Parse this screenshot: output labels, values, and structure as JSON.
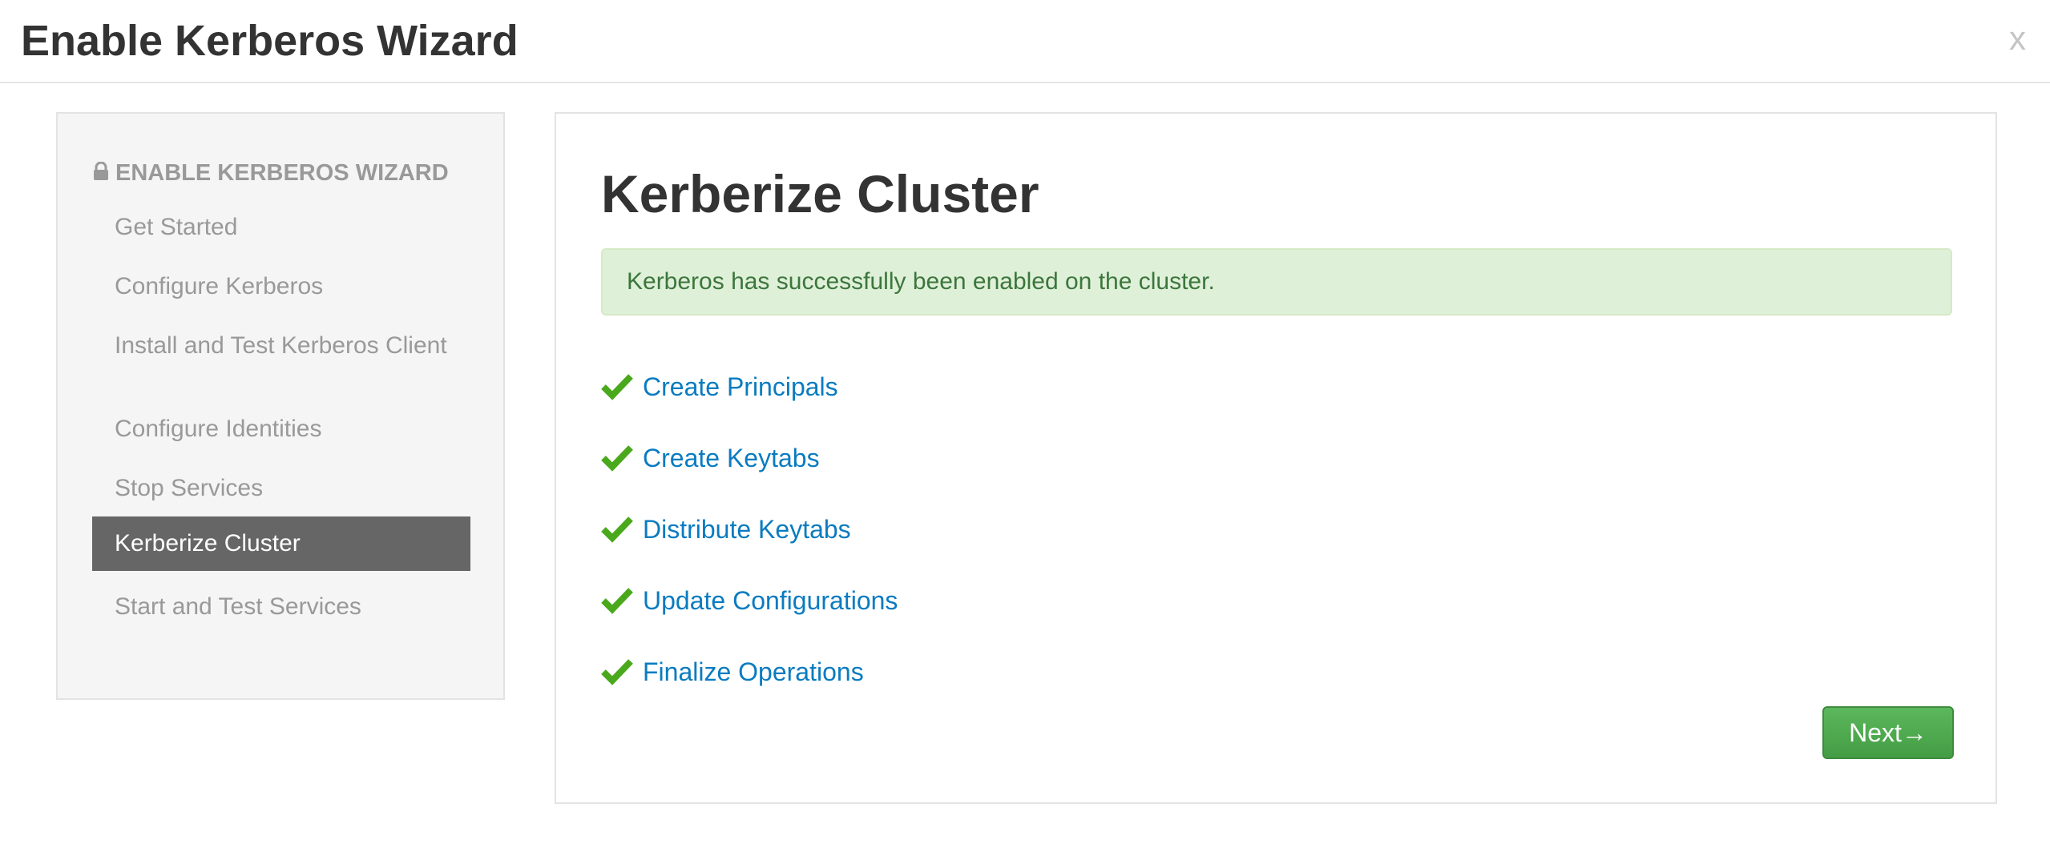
{
  "modal": {
    "title": "Enable Kerberos Wizard",
    "close_label": "x"
  },
  "sidebar": {
    "header": "ENABLE KERBEROS WIZARD",
    "items": [
      {
        "label": "Get Started",
        "active": false
      },
      {
        "label": "Configure Kerberos",
        "active": false
      },
      {
        "label": "Install and Test Kerberos Client",
        "active": false
      },
      {
        "label": "Configure Identities",
        "active": false
      },
      {
        "label": "Stop Services",
        "active": false
      },
      {
        "label": "Kerberize Cluster",
        "active": true
      },
      {
        "label": "Start and Test Services",
        "active": false
      }
    ]
  },
  "main": {
    "title": "Kerberize Cluster",
    "alert": "Kerberos has successfully been enabled on the cluster.",
    "steps": [
      {
        "label": "Create Principals",
        "status": "completed"
      },
      {
        "label": "Create Keytabs",
        "status": "completed"
      },
      {
        "label": "Distribute Keytabs",
        "status": "completed"
      },
      {
        "label": "Update Configurations",
        "status": "completed"
      },
      {
        "label": "Finalize Operations",
        "status": "completed"
      }
    ],
    "next_label": "Next→"
  },
  "colors": {
    "accent_green": "#5cb85c",
    "check_green": "#4aa81c",
    "link_blue": "#0a7bc0",
    "active_item_bg": "#666666",
    "alert_bg": "#dff0d8",
    "alert_text": "#3c763d"
  },
  "icons": {
    "sidebar_header": "lock-icon",
    "step_status": "check-icon",
    "close": "close-icon"
  }
}
